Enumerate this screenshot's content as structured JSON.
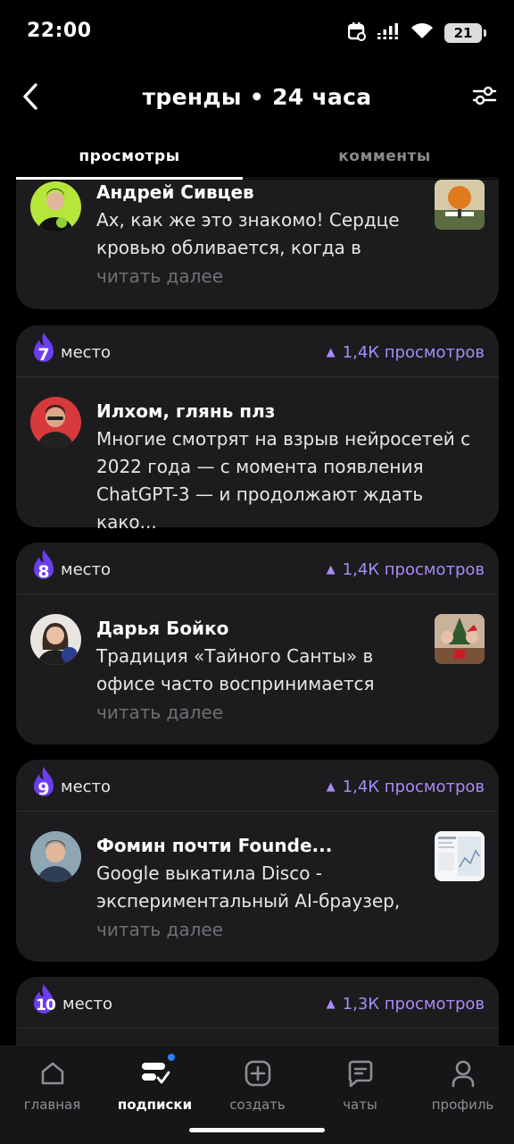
{
  "status_bar": {
    "time": "22:00",
    "battery": "21"
  },
  "header": {
    "title": "тренды • 24 часа",
    "back_icon": "chevron-left-icon",
    "filter_icon": "sliders-icon"
  },
  "tabs": [
    {
      "label": "просмотры",
      "active": true
    },
    {
      "label": "комменты",
      "active": false
    }
  ],
  "posts": [
    {
      "author": "Андрей Сивцев",
      "text": "Ах, как же это знакомо! Сердце кровью обливается, когда в",
      "read_more": "читать далее"
    },
    {
      "rank": "7",
      "place_label": "место",
      "views": "1,4К просмотров",
      "author": "Илхом, глянь плз",
      "text": "Многие смотрят на взрыв нейросетей с 2022 года — с момента появления ChatGPT-3 — и продолжают ждать како..."
    },
    {
      "rank": "8",
      "place_label": "место",
      "views": "1,4К просмотров",
      "author": "Дарья Бойко",
      "text": "Традиция «Тайного Санты» в офисе часто воспринимается",
      "read_more": "читать далее"
    },
    {
      "rank": "9",
      "place_label": "место",
      "views": "1,4К просмотров",
      "author": "Фомин почти Founde...",
      "text": "Google выкатила Disco - экспериментальный AI-браузер,",
      "read_more": "читать далее"
    },
    {
      "rank": "10",
      "place_label": "место",
      "views": "1,3К просмотров"
    }
  ],
  "bottom_nav": [
    {
      "label": "главная",
      "icon": "home-icon",
      "active": false
    },
    {
      "label": "подписки",
      "icon": "subscriptions-icon",
      "active": true,
      "badge": true
    },
    {
      "label": "создать",
      "icon": "plus-square-icon",
      "active": false
    },
    {
      "label": "чаты",
      "icon": "chat-icon",
      "active": false
    },
    {
      "label": "профиль",
      "icon": "user-icon",
      "active": false
    }
  ],
  "colors": {
    "accent": "#a78bfa",
    "flame": "#6d3df0",
    "card": "#1c1c1e",
    "badge": "#2f7df6"
  }
}
